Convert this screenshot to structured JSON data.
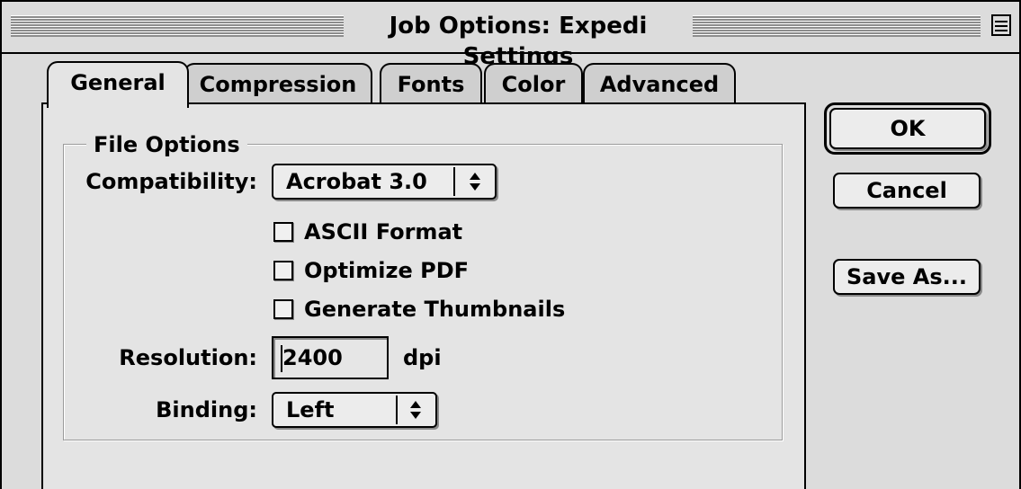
{
  "window": {
    "title": "Job Options: Expedi Settings"
  },
  "tabs": [
    {
      "label": "General",
      "active": true
    },
    {
      "label": "Compression",
      "active": false
    },
    {
      "label": "Fonts",
      "active": false
    },
    {
      "label": "Color",
      "active": false
    },
    {
      "label": "Advanced",
      "active": false
    }
  ],
  "file_options": {
    "group_title": "File Options",
    "compatibility": {
      "label": "Compatibility:",
      "value": "Acrobat 3.0"
    },
    "checkboxes": [
      {
        "label": "ASCII Format",
        "checked": false
      },
      {
        "label": "Optimize PDF",
        "checked": false
      },
      {
        "label": "Generate Thumbnails",
        "checked": false
      }
    ],
    "resolution": {
      "label": "Resolution:",
      "value": "2400",
      "unit": "dpi"
    },
    "binding": {
      "label": "Binding:",
      "value": "Left"
    }
  },
  "buttons": {
    "ok": "OK",
    "cancel": "Cancel",
    "save_as": "Save As..."
  },
  "icons": {
    "collapse": "collapse-box-icon",
    "popup_arrows": "up-down-arrows-icon"
  }
}
